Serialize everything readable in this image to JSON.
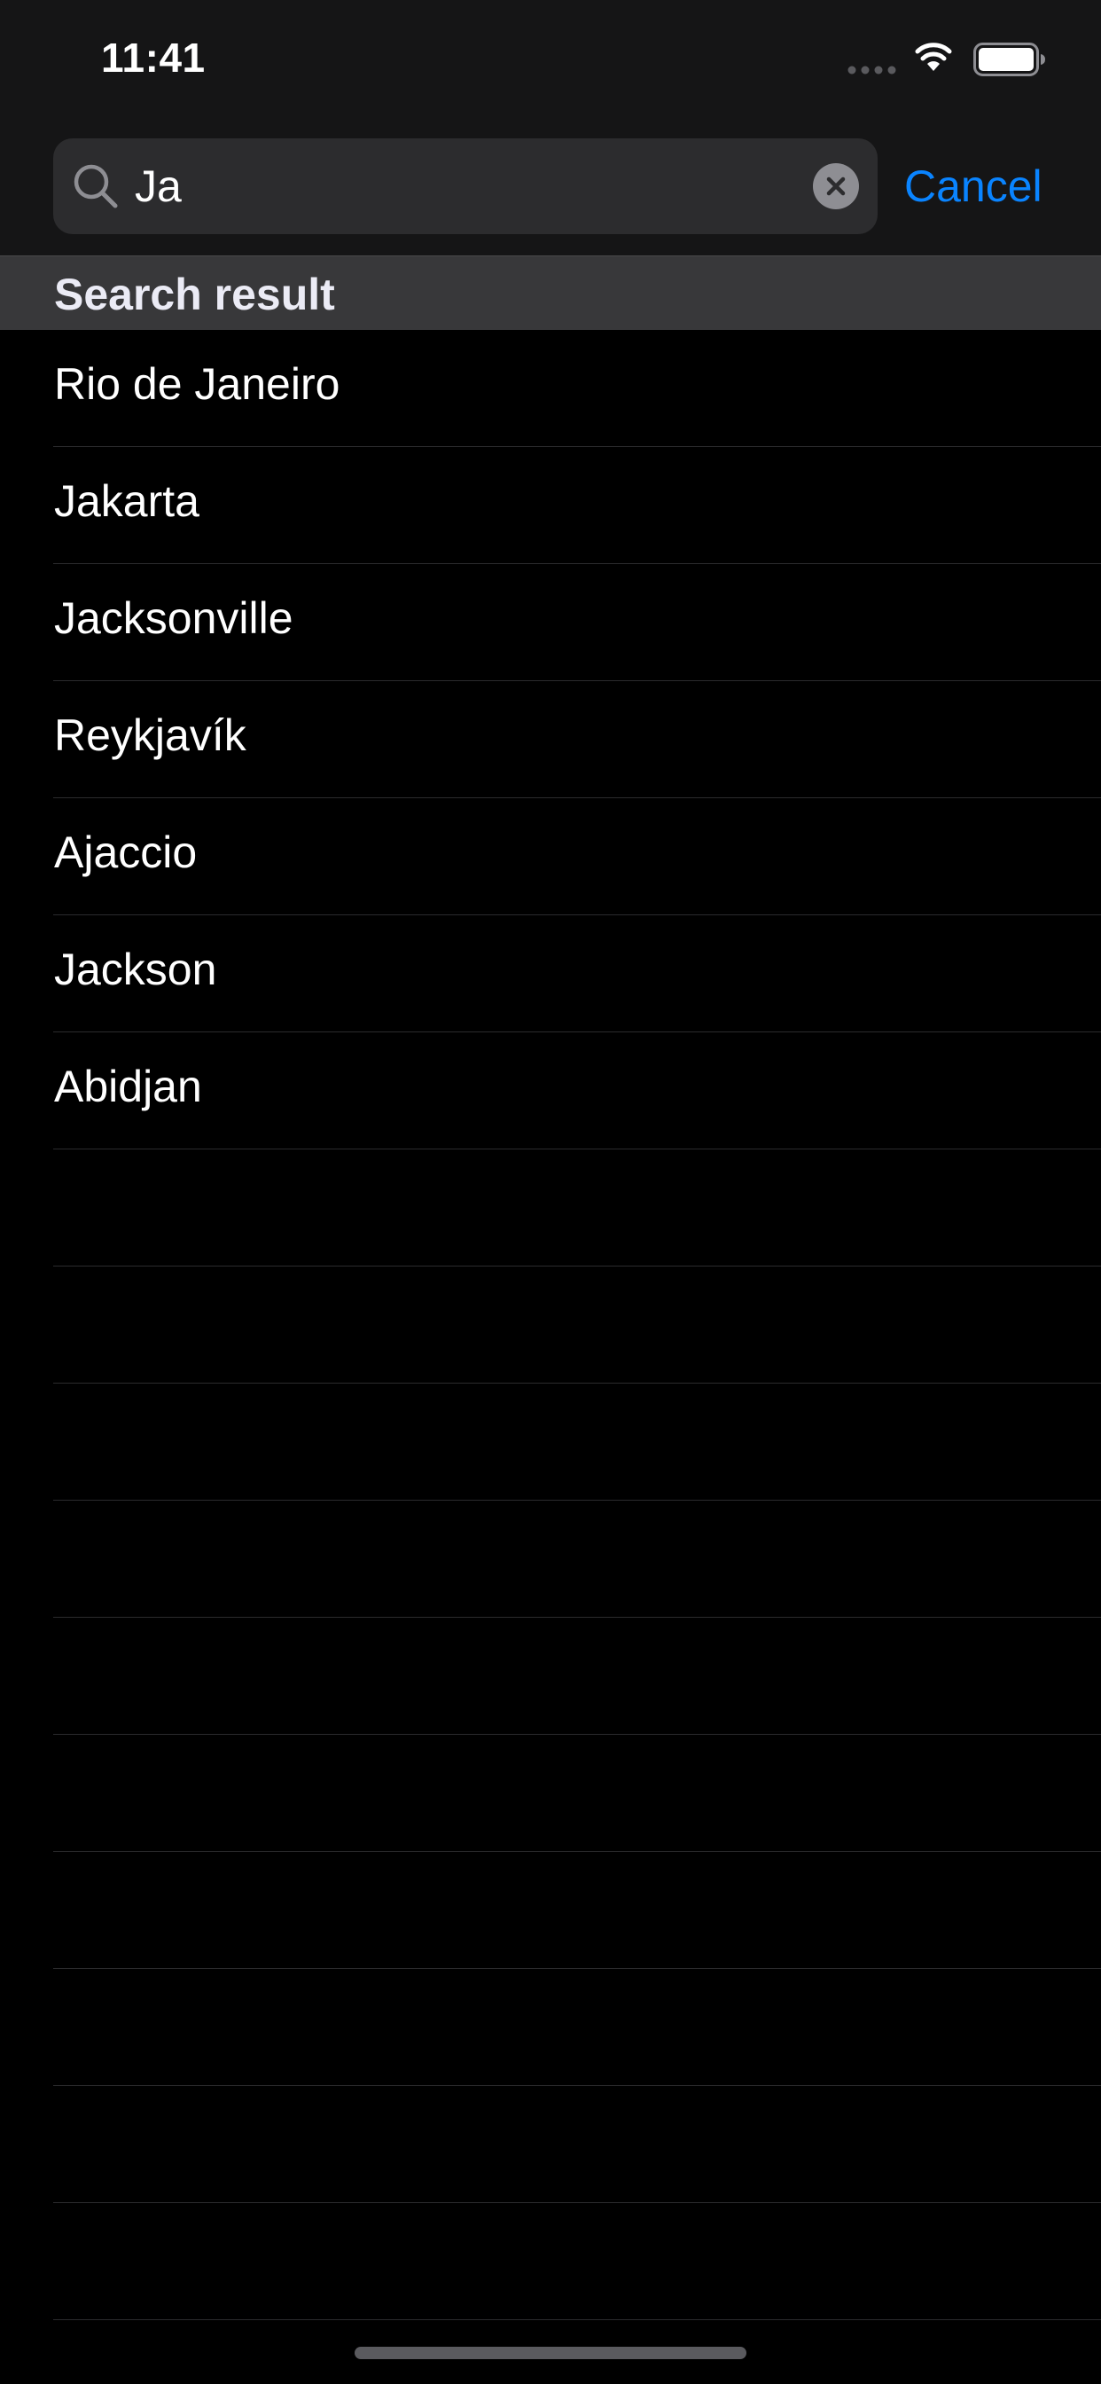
{
  "status_bar": {
    "time": "11:41",
    "icons": [
      "signal-dots-icon",
      "wifi-icon",
      "battery-icon"
    ]
  },
  "search": {
    "value": "Ja",
    "placeholder": "",
    "cancel_label": "Cancel"
  },
  "section": {
    "title": "Search result"
  },
  "results": [
    {
      "label": "Rio de Janeiro"
    },
    {
      "label": "Jakarta"
    },
    {
      "label": "Jacksonville"
    },
    {
      "label": "Reykjavík"
    },
    {
      "label": "Ajaccio"
    },
    {
      "label": "Jackson"
    },
    {
      "label": "Abidjan"
    }
  ],
  "colors": {
    "accent": "#0a84ff",
    "background": "#000000",
    "top_bar": "#151516",
    "search_field": "#2c2c2e",
    "section_header": "#38383a",
    "separator": "#2b2b2d"
  }
}
